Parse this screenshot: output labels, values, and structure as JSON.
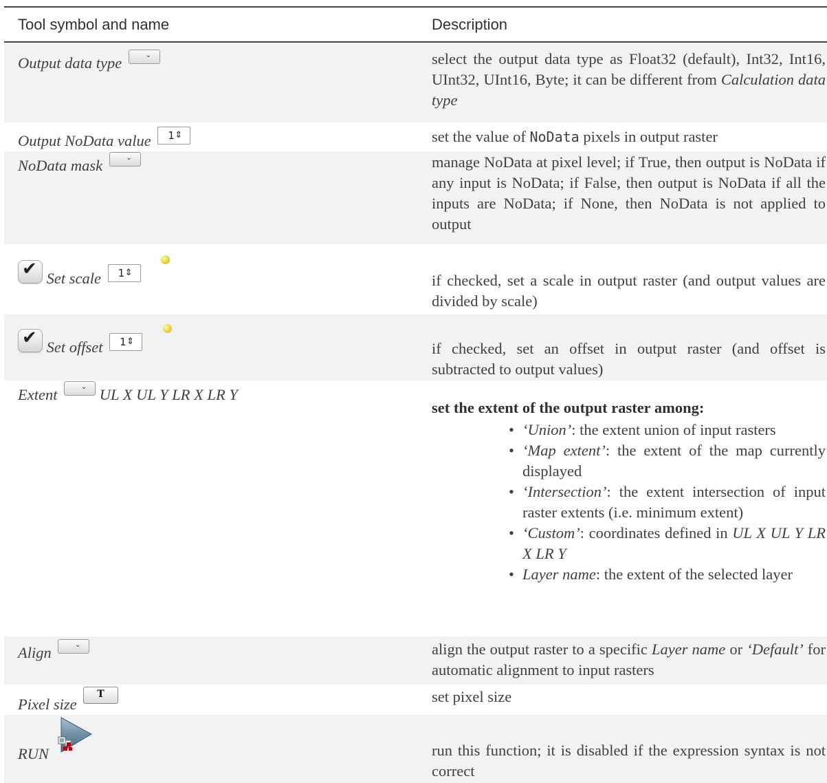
{
  "headers": {
    "col1": "Tool symbol and name",
    "col2": "Description"
  },
  "rows": {
    "output_data_type": {
      "name": "Output data type",
      "desc": "select the output data type as Float32 (default), Int32, Int16, UInt32, UInt16, Byte; it can be different from",
      "desc_italic": "Calculation data type"
    },
    "output_nodata": {
      "name": "Output NoData value",
      "spin": "1",
      "desc_pre": "set the value of",
      "desc_code": "NoData",
      "desc_post": "pixels in output raster"
    },
    "nodata_mask": {
      "name": "NoData mask",
      "desc": "manage NoData at pixel level; if True, then output is NoData if any input is NoData; if False, then output is NoData if all the inputs are NoData; if None, then NoData is not applied to output"
    },
    "set_scale": {
      "name": "Set scale",
      "spin": "1",
      "desc": "if checked, set a scale in output raster (and output values are divided by scale)"
    },
    "set_offset": {
      "name": "Set offset",
      "spin": "1",
      "desc": "if checked, set an offset in output raster (and offset is subtracted to output values)"
    },
    "extent": {
      "name": "Extent",
      "name_suffix": "UL X UL Y LR X LR Y",
      "desc_title": "set the extent of the output raster among:",
      "options": [
        {
          "term": "‘Union’",
          "text": ": the extent union of input rasters"
        },
        {
          "term": "‘Map extent’",
          "text": ": the extent of the map currently displayed"
        },
        {
          "term": "‘Intersection’",
          "text": ": the extent intersection of input raster extents (i.e. minimum extent)"
        },
        {
          "term": "‘Custom’",
          "text": ": coordinates defined in ",
          "tail_italic": "UL X UL Y LR X LR Y"
        },
        {
          "term": "Layer name",
          "text": ": the extent of the selected layer"
        }
      ]
    },
    "align": {
      "name": "Align",
      "desc_a": "align the output raster to a specific",
      "desc_b": "Layer name",
      "desc_c": "or",
      "desc_d": "‘Default’",
      "desc_e": "for automatic alignment to input rasters"
    },
    "pixel_size": {
      "name": "Pixel size",
      "button_glyph": "T",
      "desc": "set pixel size"
    },
    "run": {
      "name": "RUN",
      "desc": "run this function; it is disabled if the expression syntax is not correct"
    }
  },
  "icons": {
    "combo": "dropdown-icon",
    "spin": "spinbox-icon",
    "check": "checkbox-checked-icon",
    "dot": "yellow-status-dot-icon",
    "run": "run-arrow-icon"
  }
}
